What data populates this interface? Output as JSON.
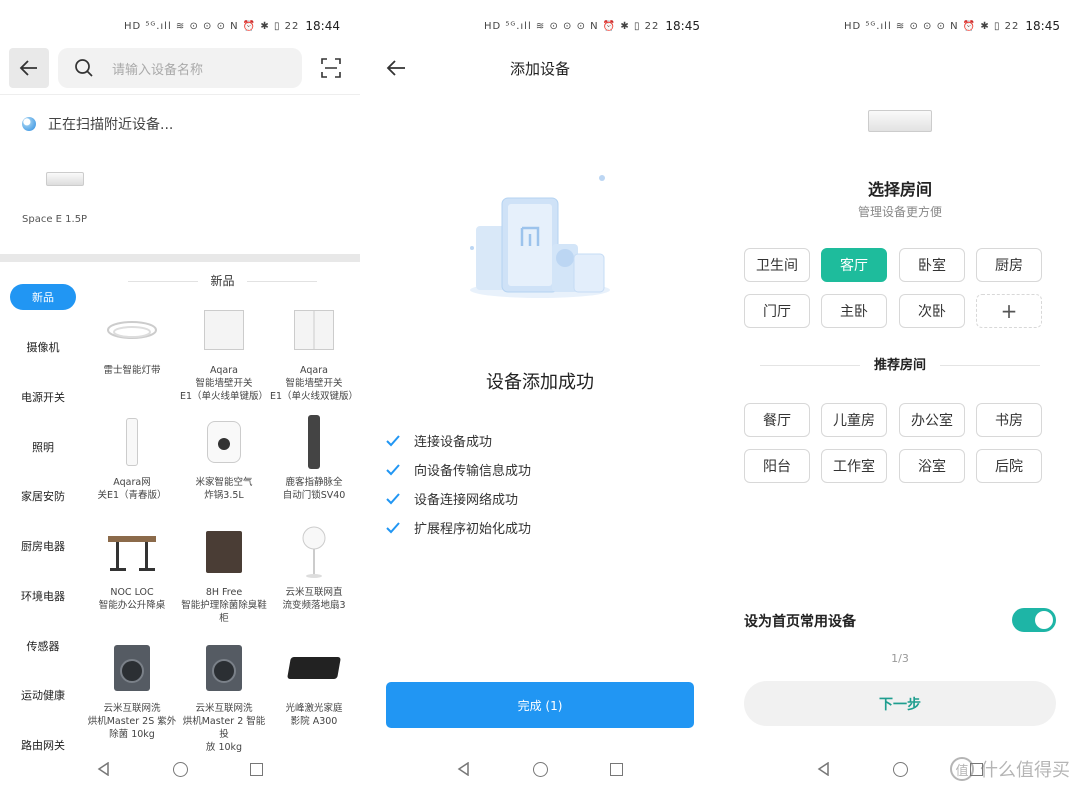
{
  "status_bar": {
    "p1_time": "18:44",
    "p2_time": "18:45",
    "p3_time": "18:45",
    "icons_text": "HD ⁵ᴳ.ıll ≋ ⊙ ⊙ ⊙   N ⏰ ✱ ▯ 22"
  },
  "panel1": {
    "search_placeholder": "请输入设备名称",
    "scanning_text": "正在扫描附近设备...",
    "found_device": "Space E 1.5P",
    "categories": [
      "新品",
      "摄像机",
      "电源开关",
      "照明",
      "家居安防",
      "厨房电器",
      "环境电器",
      "传感器",
      "运动健康",
      "路由网关"
    ],
    "section_title": "新品",
    "products": [
      {
        "name": "雷士智能灯带",
        "icon": "led-strip-icon"
      },
      {
        "name": "Aqara\n智能墙壁开关\nE1（单火线单键版）",
        "icon": "wall-switch-single-icon"
      },
      {
        "name": "Aqara\n智能墙壁开关\nE1（单火线双键版）",
        "icon": "wall-switch-double-icon"
      },
      {
        "name": "Aqara网\n关E1（青春版）",
        "icon": "gateway-icon"
      },
      {
        "name": "米家智能空气\n炸锅3.5L",
        "icon": "air-fryer-icon"
      },
      {
        "name": "鹿客指静脉全\n自动门锁SV40",
        "icon": "door-lock-icon"
      },
      {
        "name": "NOC LOC\n智能办公升降桌",
        "icon": "standing-desk-icon"
      },
      {
        "name": "8H Free\n智能护理除菌除臭鞋\n柜",
        "icon": "shoe-cabinet-icon"
      },
      {
        "name": "云米互联网直\n流变频落地扇3",
        "icon": "floor-fan-icon"
      },
      {
        "name": "云米互联网洗\n烘机Master 2S 紫外\n除菌 10kg",
        "icon": "washer-icon"
      },
      {
        "name": "云米互联网洗\n烘机Master 2 智能投\n放 10kg",
        "icon": "washer-icon"
      },
      {
        "name": "光峰激光家庭\n影院 A300",
        "icon": "projector-icon"
      }
    ]
  },
  "panel2": {
    "title": "添加设备",
    "success_text": "设备添加成功",
    "steps": [
      "连接设备成功",
      "向设备传输信息成功",
      "设备连接网络成功",
      "扩展程序初始化成功"
    ],
    "done_button": "完成 (1)"
  },
  "panel3": {
    "title": "选择房间",
    "subtitle": "管理设备更方便",
    "rooms": [
      "卫生间",
      "客厅",
      "卧室",
      "厨房",
      "门厅",
      "主卧",
      "次卧"
    ],
    "selected_room": "客厅",
    "add_room": "+",
    "recommended_title": "推荐房间",
    "recommended_rooms": [
      "餐厅",
      "儿童房",
      "办公室",
      "书房",
      "阳台",
      "工作室",
      "浴室",
      "后院"
    ],
    "favorite_label": "设为首页常用设备",
    "favorite_enabled": true,
    "pager": "1/3",
    "next_button": "下一步",
    "watermark": "什么值得买"
  },
  "colors": {
    "blue": "#2196f3",
    "teal": "#1ebc9c",
    "toggle": "#1eb5a6"
  }
}
